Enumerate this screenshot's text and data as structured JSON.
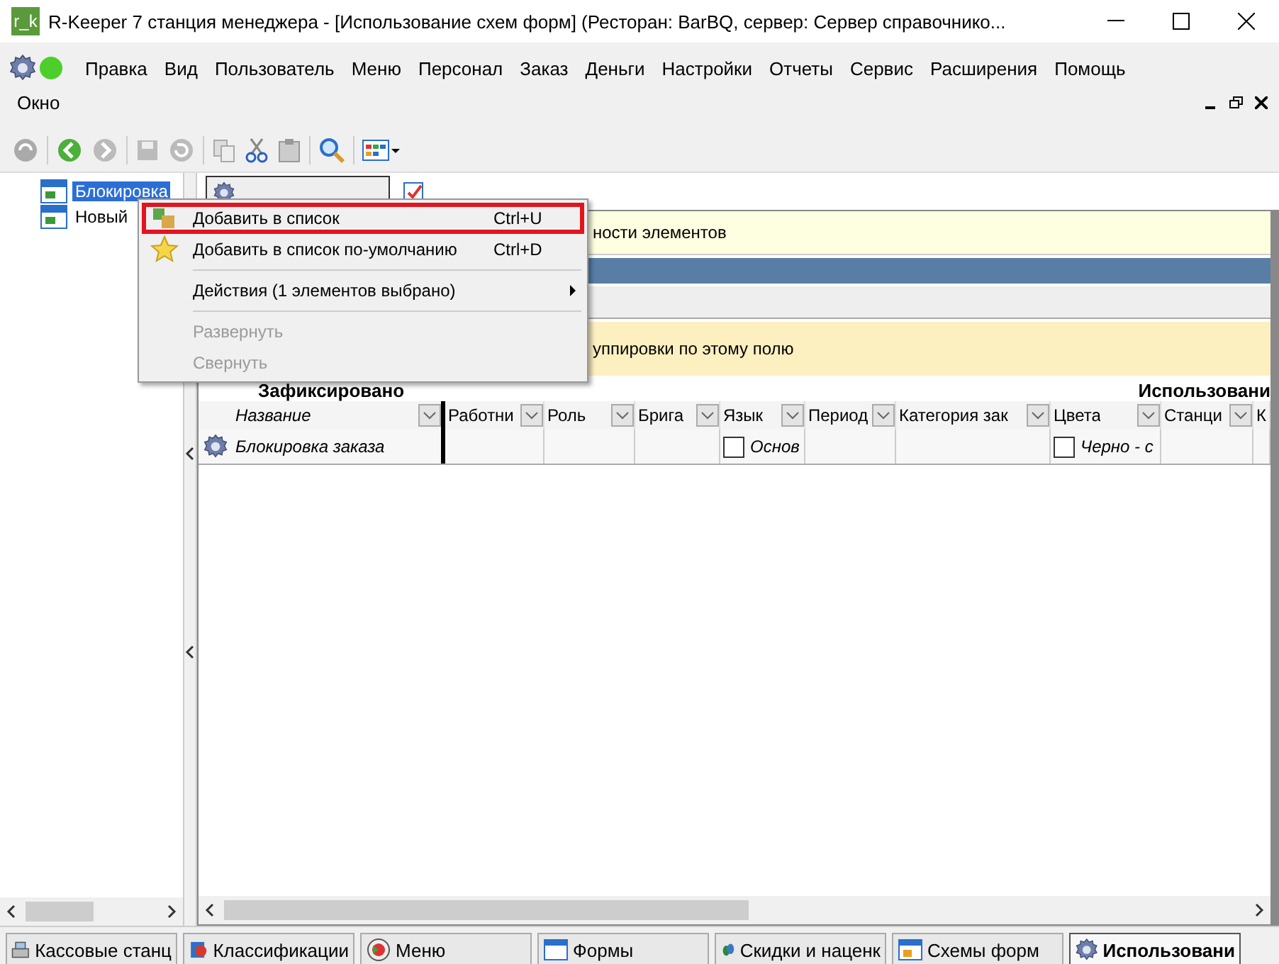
{
  "window": {
    "app_icon": "r_k",
    "title": "R-Keeper 7 станция менеджера - [Использование схем форм] (Ресторан: BarBQ, сервер: Сервер справочнико..."
  },
  "menu": [
    "Правка",
    "Вид",
    "Пользователь",
    "Меню",
    "Персонал",
    "Заказ",
    "Деньги",
    "Настройки",
    "Отчеты",
    "Сервис",
    "Расширения",
    "Помощь"
  ],
  "menu_second_row": [
    "Окно"
  ],
  "tree": [
    {
      "label": "Блокировка",
      "selected": true
    },
    {
      "label": "Новый",
      "selected": false
    }
  ],
  "tabs": [
    {
      "selected": true
    },
    {
      "selected": false
    }
  ],
  "hint_bar": "ности элементов",
  "group_hint": "уппировки по этому полю",
  "grid": {
    "fixed_title": "Зафиксировано",
    "usage_title": "Использовани",
    "columns": [
      "Название",
      "Работни",
      "Роль",
      "Брига",
      "Язык",
      "Период",
      "Категория зак",
      "Цвета",
      "Станци",
      "К"
    ],
    "rows": [
      {
        "name": "Блокировка заказа",
        "values": [
          {
            "kind": "empty"
          },
          {
            "kind": "empty"
          },
          {
            "kind": "empty"
          },
          {
            "kind": "check",
            "text": "Основ",
            "checked": false
          },
          {
            "kind": "empty"
          },
          {
            "kind": "empty"
          },
          {
            "kind": "check",
            "text": "Черно - с",
            "checked": false
          },
          {
            "kind": "empty"
          },
          {
            "kind": "empty"
          }
        ]
      }
    ]
  },
  "context_menu": [
    {
      "kind": "item",
      "label": "Добавить в список",
      "shortcut": "Ctrl+U",
      "disabled": false,
      "highlighted": true
    },
    {
      "kind": "item",
      "label": "Добавить в список по-умолчанию",
      "shortcut": "Ctrl+D",
      "disabled": false,
      "highlighted": false
    },
    {
      "kind": "separator"
    },
    {
      "kind": "submenu",
      "label": "Действия (1 элементов выбрано)",
      "disabled": false,
      "highlighted": false
    },
    {
      "kind": "separator"
    },
    {
      "kind": "item",
      "label": "Развернуть",
      "disabled": true,
      "highlighted": false
    },
    {
      "kind": "item",
      "label": "Свернуть",
      "disabled": true,
      "highlighted": false
    }
  ],
  "taskbar": [
    {
      "label": "Кассовые станц",
      "selected": false
    },
    {
      "label": "Классификации",
      "selected": false
    },
    {
      "label": "Меню",
      "selected": false
    },
    {
      "label": "Формы",
      "selected": false
    },
    {
      "label": "Скидки и наценк",
      "selected": false
    },
    {
      "label": "Схемы форм",
      "selected": false
    },
    {
      "label": "Использовани",
      "selected": true
    }
  ]
}
